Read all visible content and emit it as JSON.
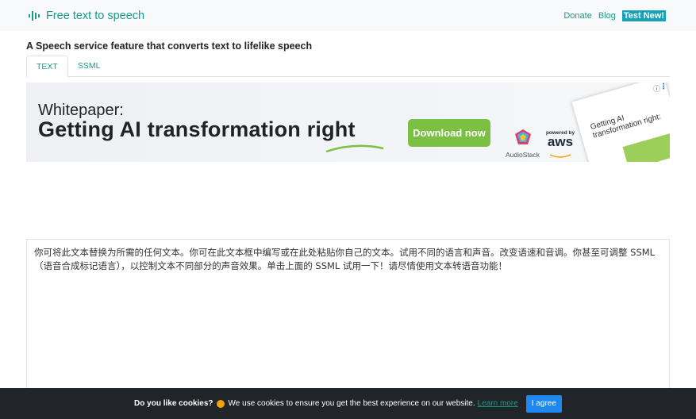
{
  "navbar": {
    "brand": "Free text to speech",
    "links": {
      "donate": "Donate",
      "blog": "Blog",
      "test_new": "Test New!"
    }
  },
  "page": {
    "title": "A Speech service feature that converts text to lifelike speech"
  },
  "tabs": [
    {
      "label": "TEXT",
      "active": true
    },
    {
      "label": "SSML",
      "active": false
    }
  ],
  "ad": {
    "kicker": "Whitepaper:",
    "headline": "Getting AI transformation right",
    "button": "Download now",
    "partner1": "AudioStack",
    "partner2_small": "powered by",
    "partner2": "aws",
    "book_title": "Getting AI transformation right:",
    "info_icon": "info-icon",
    "menu_icon": "kebab-menu-icon"
  },
  "editor": {
    "text": "你可将此文本替换为所需的任何文本。你可在此文本框中编写或在此处粘贴你自己的文本。试用不同的语言和声音。改变语速和音调。你甚至可调整 SSML（语音合成标记语言），以控制文本不同部分的声音效果。单击上面的 SSML 试用一下！请尽情使用文本转语音功能！"
  },
  "cookie": {
    "question": "Do you like cookies?",
    "message": "We use cookies to ensure you get the best experience on our website.",
    "learn_more": "Learn more",
    "agree": "I agree"
  },
  "colors": {
    "accent": "#1a9b8a",
    "badge": "#17a2b8",
    "ad_button": "#7bc043",
    "cookie_bg": "#212529",
    "agree": "#1e88f0"
  }
}
